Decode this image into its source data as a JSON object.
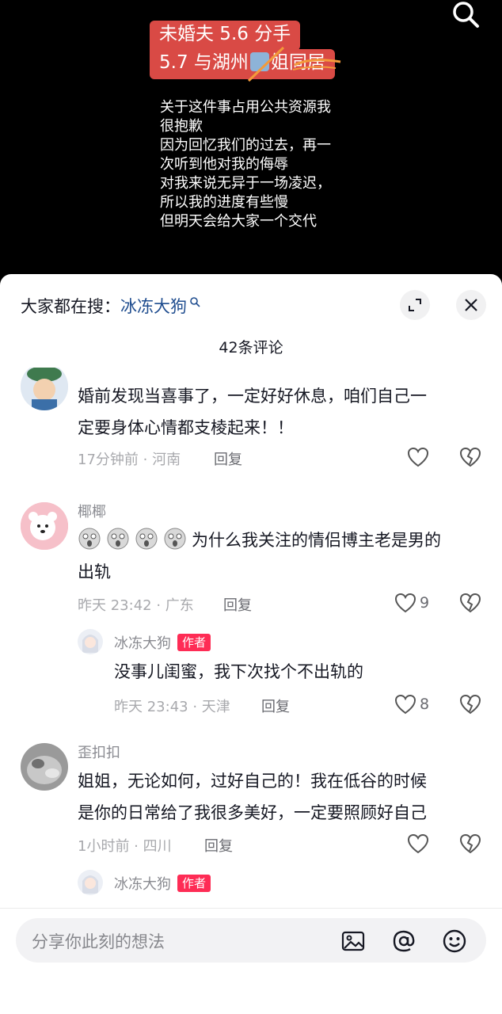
{
  "video": {
    "title_line1": "未婚夫 5.6 分手",
    "title_line2_part1": "5.7 与湖州",
    "title_line2_part2": "姐同居",
    "body_lines": [
      "关于这件事占用公共资源我",
      "很抱歉",
      "因为回忆我们的过去，再一",
      "次听到他对我的侮辱",
      "对我来说无异于一场凌迟，",
      "所以我的进度有些慢",
      "但明天会给大家一个交代"
    ]
  },
  "sheet": {
    "search_prefix": "大家都在搜：",
    "search_term": "冰冻大狗",
    "comment_count_title": "42条评论"
  },
  "comments": [
    {
      "username": "",
      "text_line1": "婚前发现当喜事了，一定好好休息，咱们自己一",
      "text_line2": "定要身体心情都支棱起来！！",
      "meta": "17分钟前 · 河南",
      "reply_label": "回复",
      "likes": ""
    },
    {
      "username": "椰椰",
      "text_line1_tail": "为什么我关注的情侣博主老是男的",
      "text_line2": "出轨",
      "meta": "昨天 23:42 · 广东",
      "reply_label": "回复",
      "likes": "9"
    },
    {
      "username": "冰冻大狗",
      "badge": "作者",
      "text_line1": "没事儿闺蜜，我下次找个不出轨的",
      "meta": "昨天 23:43 · 天津",
      "reply_label": "回复",
      "likes": "8"
    },
    {
      "username": "歪扣扣",
      "text_line1": "姐姐，无论如何，过好自己的！我在低谷的时候",
      "text_line2": "是你的日常给了我很多美好，一定要照顾好自己",
      "meta": "1小时前 · 四川",
      "reply_label": "回复",
      "likes": ""
    },
    {
      "username": "冰冻大狗",
      "badge": "作者"
    }
  ],
  "input": {
    "placeholder": "分享你此刻的想法"
  },
  "colors": {
    "title_red": "#d94a45",
    "author_badge": "#fe2c55",
    "search_term_blue": "#1f4d8f"
  },
  "icons": [
    "search-icon",
    "expand-icon",
    "close-icon",
    "heart-icon",
    "broken-heart-icon",
    "image-icon",
    "at-icon",
    "emoji-icon",
    "shocked-face-icon"
  ]
}
